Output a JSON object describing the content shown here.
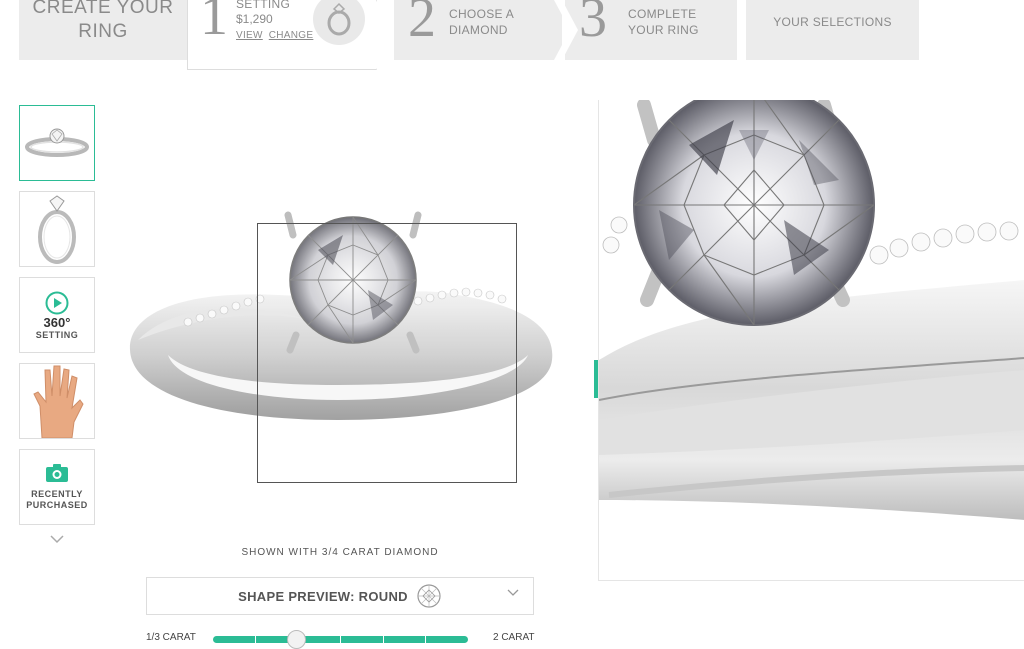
{
  "steps": {
    "create": {
      "line1": "CREATE YOUR",
      "line2": "RING"
    },
    "setting": {
      "number": "1",
      "label": "SETTING",
      "price": "$1,290",
      "view": "VIEW",
      "change": "CHANGE"
    },
    "diamond": {
      "number": "2",
      "line1": "CHOOSE A",
      "line2": "DIAMOND"
    },
    "complete": {
      "number": "3",
      "line1": "COMPLETE",
      "line2": "YOUR RING"
    },
    "selections": "YOUR SELECTIONS"
  },
  "thumbnails": [
    {
      "name": "ring-front",
      "active": true
    },
    {
      "name": "ring-side"
    },
    {
      "name": "360",
      "big": "360°",
      "label": "SETTING"
    },
    {
      "name": "hand"
    },
    {
      "name": "recent",
      "line1": "RECENTLY",
      "line2": "PURCHASED"
    }
  ],
  "main": {
    "shown_with": "SHOWN WITH 3/4 CARAT DIAMOND",
    "shape_preview": "SHAPE PREVIEW: ROUND",
    "carat_min": "1/3 CARAT",
    "carat_max": "2 CARAT"
  },
  "colors": {
    "accent": "#2bbc95",
    "step_bg": "#ececec",
    "text_gray": "#8a8a8a"
  },
  "icons": {
    "ring": "ring-icon",
    "play": "play-icon",
    "camera": "camera-icon",
    "chevron": "chevron-down-icon",
    "round_diamond": "round-diamond-icon"
  }
}
